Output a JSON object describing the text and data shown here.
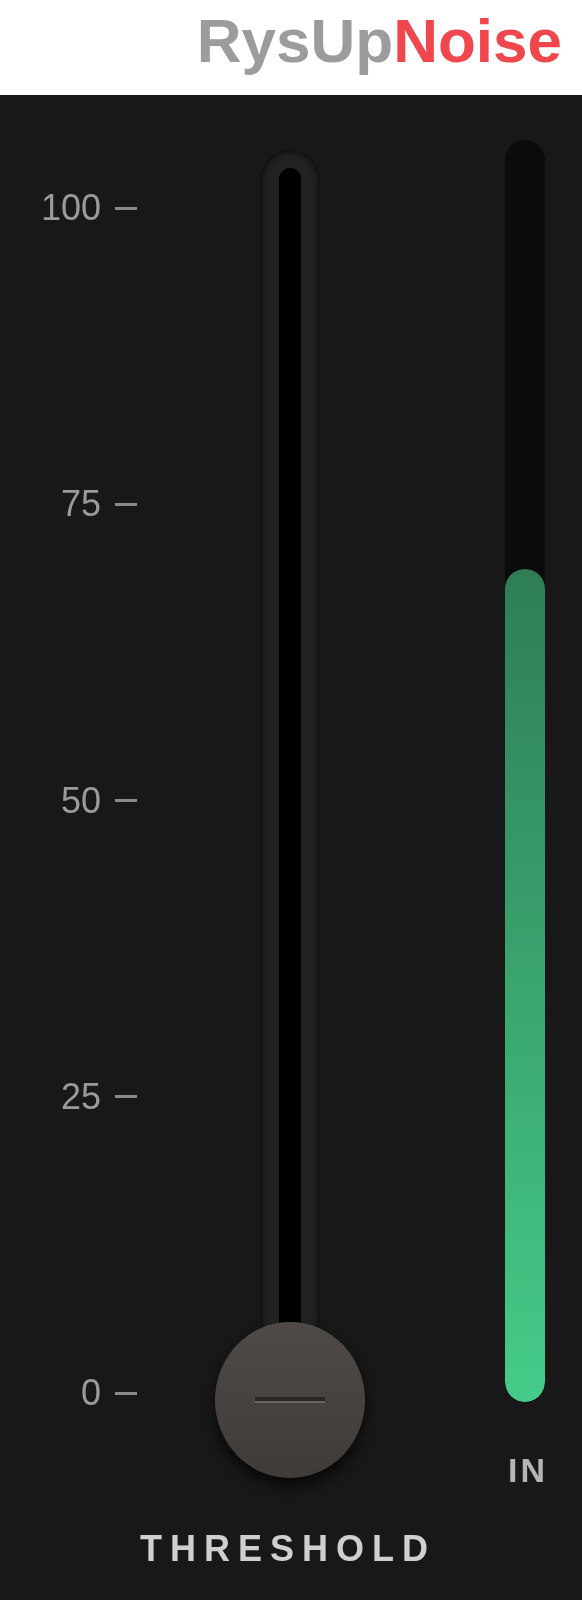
{
  "header": {
    "title_parts": [
      {
        "text": "RysUp",
        "kind": "plain"
      },
      {
        "text": "Noise",
        "kind": "accent"
      }
    ]
  },
  "scale": {
    "ticks": [
      "100",
      "75",
      "50",
      "25",
      "0"
    ]
  },
  "threshold": {
    "label": "THRESHOLD"
  },
  "meter": {
    "label": "IN",
    "level": 0.66
  }
}
